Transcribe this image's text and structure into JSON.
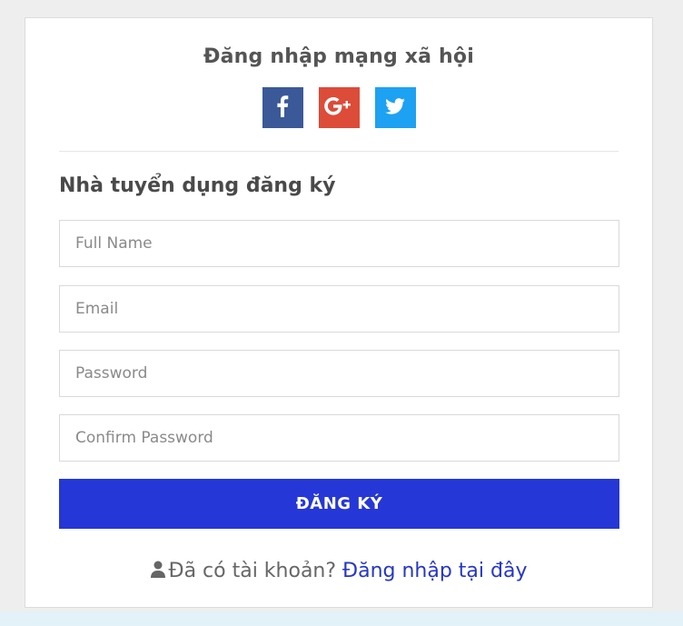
{
  "social": {
    "title": "Đăng nhập mạng xã hội",
    "buttons": [
      {
        "name": "facebook",
        "icon": "facebook-icon",
        "color": "#3b5998"
      },
      {
        "name": "google-plus",
        "icon": "google-plus-icon",
        "color": "#dd4b39"
      },
      {
        "name": "twitter",
        "icon": "twitter-icon",
        "color": "#1da1f2"
      }
    ]
  },
  "form": {
    "heading": "Nhà tuyển dụng đăng ký",
    "fields": {
      "full_name": {
        "placeholder": "Full Name",
        "value": ""
      },
      "email": {
        "placeholder": "Email",
        "value": ""
      },
      "password": {
        "placeholder": "Password",
        "value": ""
      },
      "confirm_password": {
        "placeholder": "Confirm Password",
        "value": ""
      }
    },
    "submit_label": "ĐĂNG KÝ"
  },
  "login_prompt": {
    "icon": "user-icon",
    "text": "Đã có tài khoản?",
    "link_label": "Đăng nhập tại đây"
  },
  "colors": {
    "accent": "#2537d6",
    "link": "#2537c8",
    "facebook": "#3b5998",
    "google_plus": "#dd4b39",
    "twitter": "#1da1f2"
  }
}
